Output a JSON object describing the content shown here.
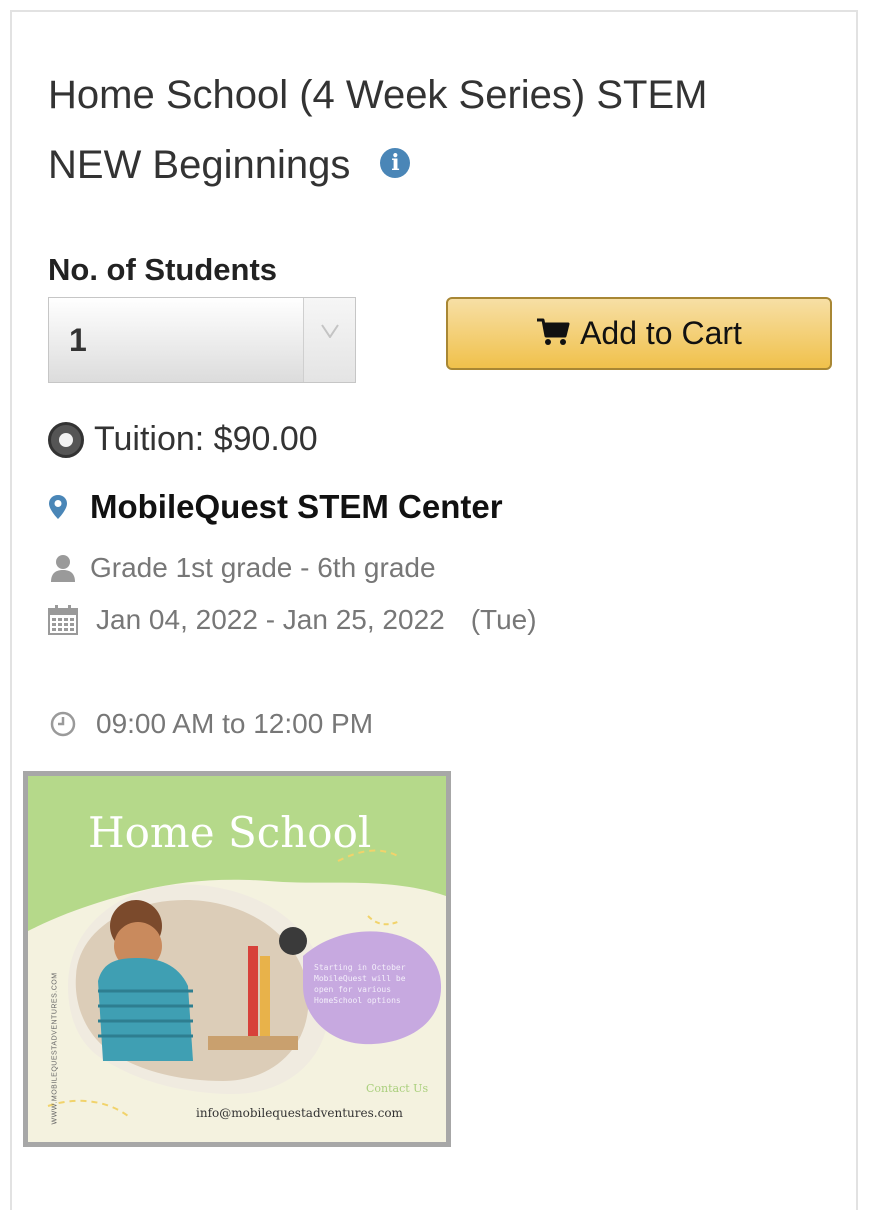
{
  "course": {
    "title": "Home School (4 Week Series) STEM NEW Beginnings",
    "info_icon": "info-circle-icon"
  },
  "students": {
    "label": "No. of Students",
    "selected_value": "1"
  },
  "cart_button": {
    "label": "Add to Cart",
    "icon": "shopping-cart-icon"
  },
  "tuition": {
    "text": "Tuition: $90.00"
  },
  "location": {
    "name": "MobileQuest STEM Center",
    "icon": "map-pin-icon"
  },
  "grade": {
    "text": "Grade 1st grade - 6th grade",
    "icon": "user-icon"
  },
  "dates": {
    "range": "Jan 04, 2022 - Jan 25, 2022",
    "day": "(Tue)",
    "icon": "calendar-icon"
  },
  "time": {
    "text": "09:00 AM to 12:00 PM",
    "icon": "clock-icon"
  },
  "flyer": {
    "title": "Home School",
    "side_text": "WWW.MOBILEQUESTADVENTURES.COM",
    "bubble_text": "Starting in October MobileQuest will be open for various HomeSchool options",
    "contact_label": "Contact Us",
    "email": "info@mobilequestadventures.com"
  },
  "colors": {
    "cart_button_bg": "#f0c14b",
    "cart_button_border": "#a88734",
    "info_icon": "#4a86b7",
    "flyer_green": "#b5d98a",
    "flyer_purple": "#c7a9e0"
  }
}
